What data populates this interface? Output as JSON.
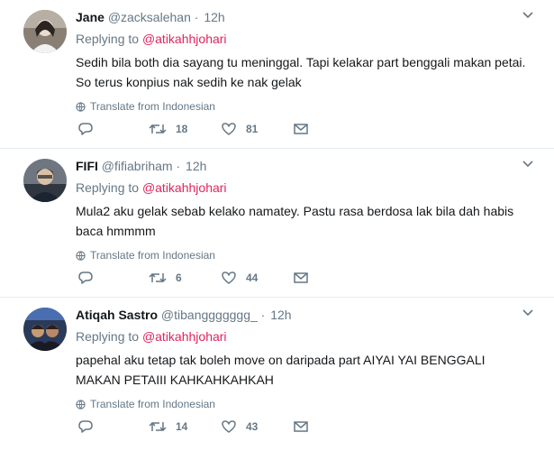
{
  "tweets": [
    {
      "name": "Jane",
      "handle": "@zacksalehan",
      "dot": "·",
      "time": "12h",
      "reply_prefix": "Replying to",
      "reply_to": "@atikahhjohari",
      "text_lines": [
        "Sedih bila both dia sayang tu meninggal. Tapi kelakar part benggali makan petai.",
        "So terus konpius nak sedih ke nak gelak"
      ],
      "translate": "Translate from Indonesian",
      "replies": "",
      "retweets": "18",
      "likes": "81"
    },
    {
      "name": "FIFI",
      "handle": "@fifiabriham",
      "dot": "·",
      "time": "12h",
      "reply_prefix": "Replying to",
      "reply_to": "@atikahhjohari",
      "text_lines": [
        "Mula2 aku gelak sebab kelako namatey. Pastu rasa berdosa lak bila dah habis",
        "baca hmmmm"
      ],
      "translate": "Translate from Indonesian",
      "replies": "",
      "retweets": "6",
      "likes": "44"
    },
    {
      "name": "Atiqah Sastro",
      "handle": "@tibanggggggg_",
      "dot": "·",
      "time": "12h",
      "reply_prefix": "Replying to",
      "reply_to": "@atikahhjohari",
      "text_lines": [
        "papehal aku tetap tak boleh move on daripada part AIYAI YAI BENGGALI",
        "MAKAN PETAIII KAHKAHKAHKAH"
      ],
      "translate": "Translate from Indonesian",
      "replies": "",
      "retweets": "14",
      "likes": "43"
    }
  ],
  "colors": {
    "mention": "#e0245e",
    "muted": "#657786",
    "divider": "#e6ecf0"
  },
  "icons": [
    "reply-icon",
    "retweet-icon",
    "like-icon",
    "message-icon",
    "globe-icon",
    "caret-down-icon"
  ]
}
